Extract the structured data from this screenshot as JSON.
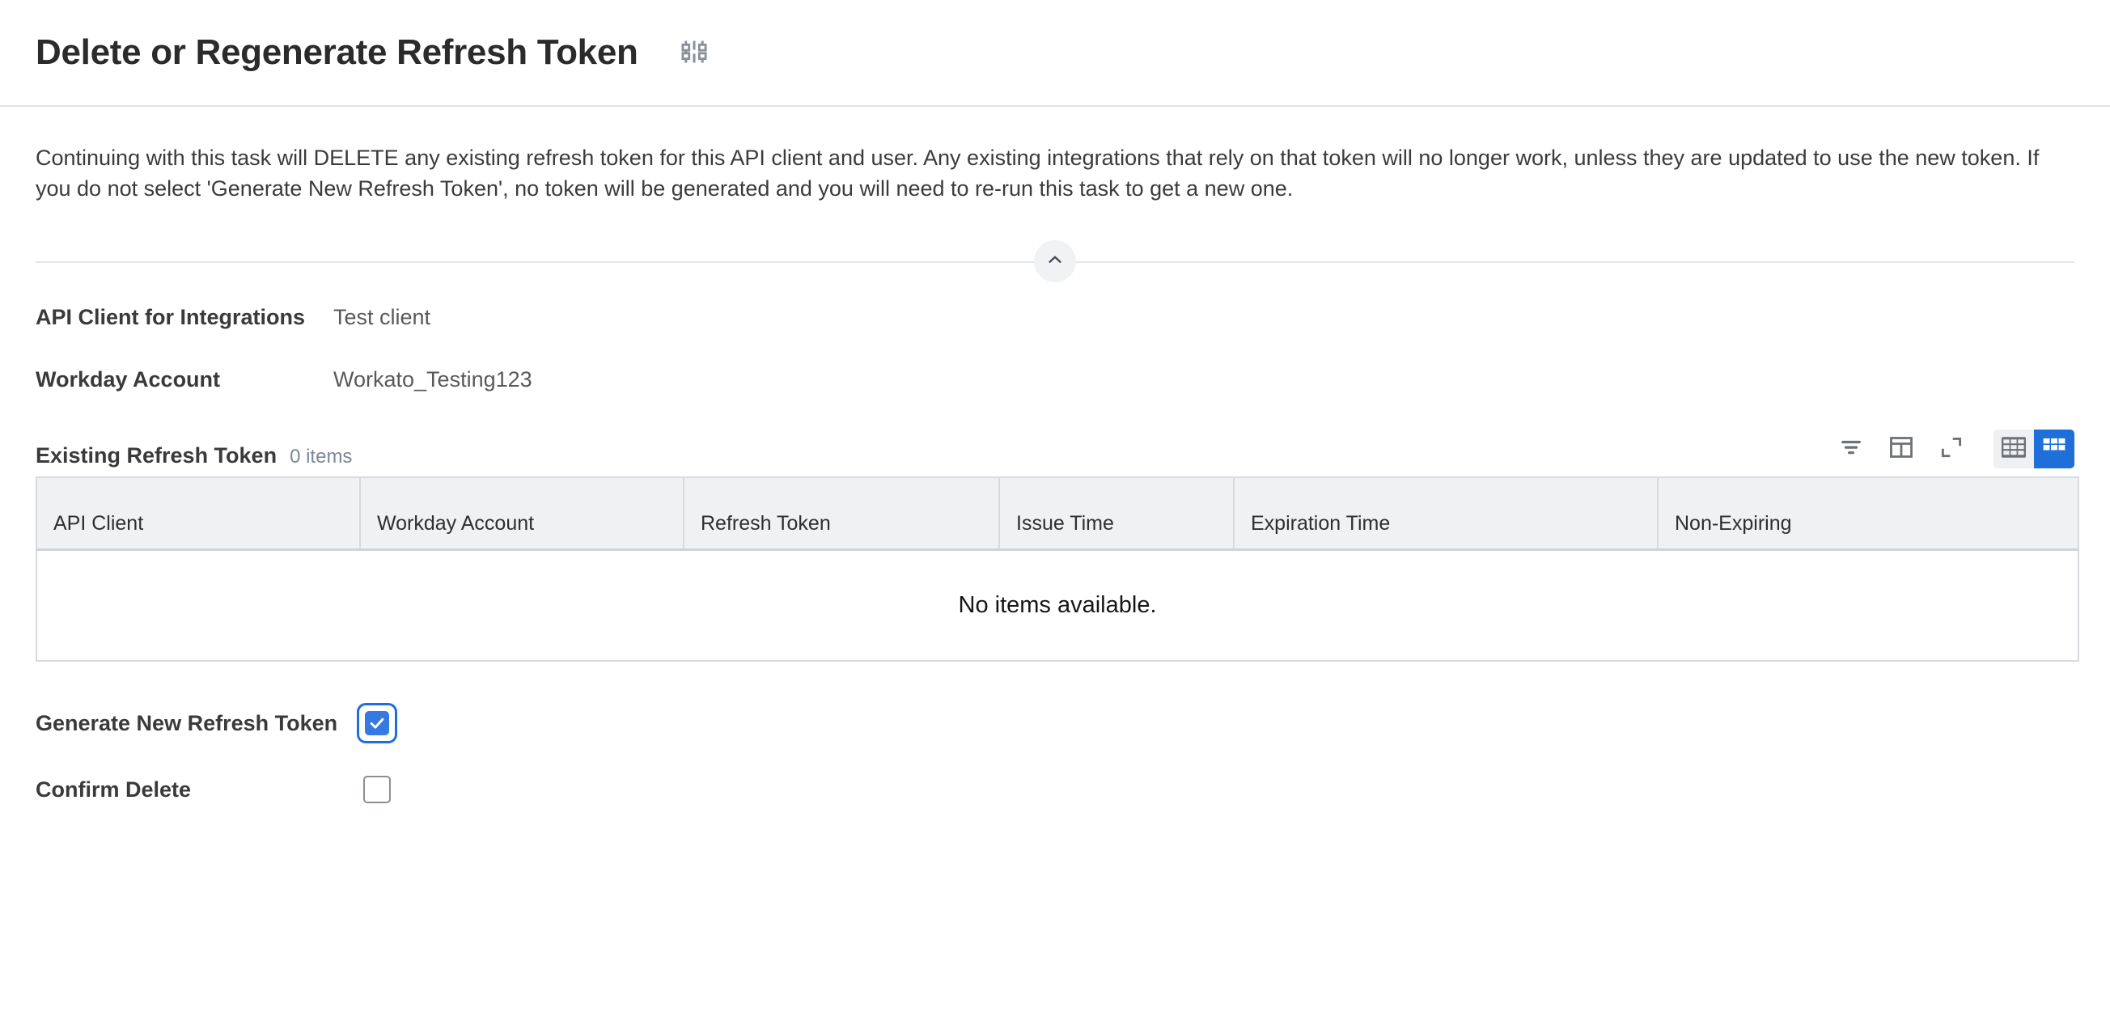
{
  "header": {
    "title": "Delete or Regenerate Refresh Token",
    "settings_icon": "sliders-settings-icon"
  },
  "intro": {
    "text": "Continuing with this task will DELETE any existing refresh token for this API client and user. Any existing integrations that rely on that token will no longer work, unless they are updated to use the new token. If you do not select 'Generate New Refresh Token', no token will be generated and you will need to re-run this task to get a new one."
  },
  "collapse": {
    "icon": "chevron-up-icon"
  },
  "fields": [
    {
      "label": "API Client for Integrations",
      "value": "Test client"
    },
    {
      "label": "Workday Account",
      "value": "Workato_Testing123"
    }
  ],
  "grid": {
    "title": "Existing Refresh Token",
    "count_label": "0 items",
    "toolbar": [
      {
        "name": "filter-icon"
      },
      {
        "name": "split-panel-icon"
      },
      {
        "name": "expand-icon"
      }
    ],
    "view_toggles": [
      {
        "name": "grid-view-button",
        "active": false
      },
      {
        "name": "grid-view-compact-button",
        "active": true
      }
    ],
    "columns": [
      "API Client",
      "Workday Account",
      "Refresh Token",
      "Issue Time",
      "Expiration Time",
      "Non-Expiring"
    ],
    "empty_message": "No items available.",
    "rows": []
  },
  "checkboxes": [
    {
      "label": "Generate New Refresh Token",
      "checked": true,
      "focused": true
    },
    {
      "label": "Confirm Delete",
      "checked": false,
      "focused": false
    }
  ],
  "colors": {
    "accent_blue": "#1e6fd9",
    "checkbox_blue": "#357ae0",
    "header_row_bg": "#f0f1f3",
    "border_gray": "#d7dbe0",
    "icon_gray": "#6e7276",
    "muted_text": "#7d8894"
  }
}
